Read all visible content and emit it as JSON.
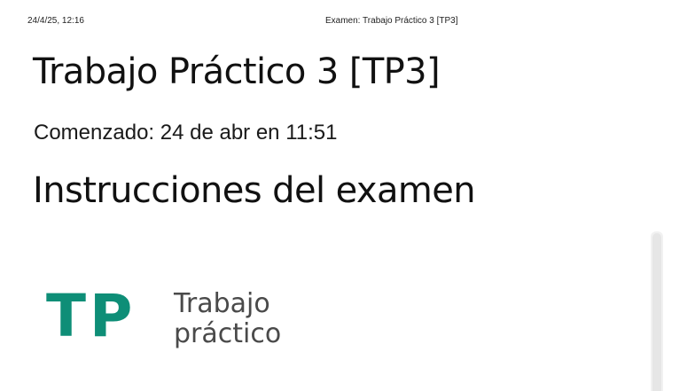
{
  "print_header": {
    "datetime": "24/4/25, 12:16",
    "document_title": "Examen: Trabajo Práctico 3 [TP3]"
  },
  "quiz": {
    "title": "Trabajo Práctico 3 [TP3]",
    "started": "Comenzado: 24 de abr en 11:51"
  },
  "instructions": {
    "heading": "Instrucciones del examen"
  },
  "logo": {
    "mark": "TP",
    "line1": "Trabajo",
    "line2": "práctico",
    "accent_color": "#0e8e77"
  }
}
